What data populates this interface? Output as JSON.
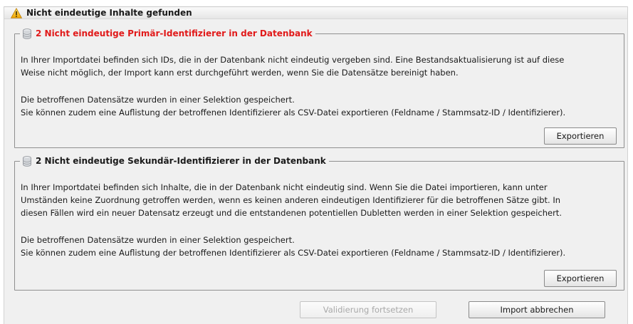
{
  "dialog": {
    "title": "Nicht eindeutige Inhalte gefunden",
    "warning_icon": "warning-triangle-icon"
  },
  "primary_group": {
    "icon": "database-icon",
    "legend": "2 Nicht eindeutige Primär-Identifizierer in der Datenbank",
    "legend_color": "#e11a1a",
    "paragraph1_line1": "In Ihrer Importdatei befinden sich IDs, die in der Datenbank nicht eindeutig vergeben sind. Eine Bestandsaktualisierung ist auf diese",
    "paragraph1_line2": "Weise nicht möglich, der Import kann erst durchgeführt werden, wenn Sie die Datensätze bereinigt haben.",
    "paragraph2_line1": "Die betroffenen Datensätze wurden in einer Selektion gespeichert.",
    "paragraph2_line2": "Sie können zudem eine Auflistung der betroffenen Identifizierer als CSV-Datei exportieren (Feldname / Stammsatz-ID / Identifizierer).",
    "export_label": "Exportieren"
  },
  "secondary_group": {
    "icon": "database-icon",
    "legend": "2 Nicht eindeutige Sekundär-Identifizierer in der Datenbank",
    "paragraph1_line1": "In Ihrer Importdatei befinden sich Inhalte, die in der Datenbank nicht eindeutig sind.  Wenn Sie die Datei importieren, kann unter",
    "paragraph1_line2": "Umständen keine Zuordnung getroffen werden, wenn es keinen anderen eindeutigen Identifizierer für die betroffenen Sätze gibt.  In",
    "paragraph1_line3": "diesen Fällen wird ein neuer Datensatz erzeugt und die entstandenen potentiellen Dubletten werden in einer Selektion gespeichert.",
    "paragraph2_line1": "Die betroffenen Datensätze wurden in einer Selektion gespeichert.",
    "paragraph2_line2": "Sie können zudem eine Auflistung der betroffenen Identifizierer als CSV-Datei exportieren (Feldname / Stammsatz-ID / Identifizierer).",
    "export_label": "Exportieren"
  },
  "footer": {
    "continue_label": "Validierung fortsetzen",
    "continue_enabled": false,
    "cancel_label": "Import abbrechen"
  }
}
